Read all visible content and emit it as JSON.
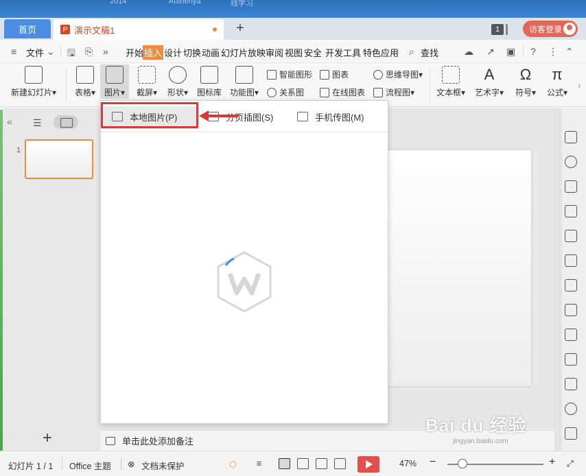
{
  "desktop": {
    "ghost_texts": [
      "2014",
      "Authenya",
      "线学习"
    ]
  },
  "tabs": {
    "home_label": "首页",
    "doc_label": "演示文稿1",
    "new_tab_symbol": "+",
    "badge_number": "1",
    "visitor_label": "访客登录"
  },
  "menubar": {
    "file_label": "文件",
    "items": [
      "开始",
      "插入",
      "设计",
      "切换",
      "动画",
      "幻灯片放映",
      "审阅",
      "视图",
      "安全",
      "开发工具",
      "特色应用"
    ],
    "active_item": "插入",
    "search_label": "查找"
  },
  "ribbon": {
    "new_slide": "新建幻灯片",
    "table": "表格",
    "picture": "图片",
    "screenshot": "截屏",
    "shape": "形状",
    "icon_lib": "图标库",
    "func_chart": "功能图",
    "smart_art": "智能图形",
    "chart": "图表",
    "relation": "关系图",
    "online_chart": "在线图表",
    "mind_map": "思维导图",
    "flow_chart": "流程图",
    "text_box": "文本框",
    "word_art": "艺术字",
    "symbol": "符号",
    "formula": "公式"
  },
  "picture_menu": {
    "options": [
      "本地图片(P)",
      "分页插图(S)",
      "手机传图(M)"
    ],
    "highlighted": "本地图片(P)"
  },
  "slides": {
    "current_number": "1"
  },
  "notes": {
    "placeholder": "单击此处添加备注"
  },
  "status": {
    "slide_counter": "幻灯片 1 / 1",
    "theme": "Office 主题",
    "protection": "文档未保护",
    "zoom": "47%",
    "zoom_fraction": 0.47
  },
  "watermark": {
    "text": "Bai du 经验",
    "sub": "jingyan.baidu.com"
  },
  "colors": {
    "accent": "#f08a3c",
    "tab_blue": "#4b8de3",
    "highlight_red": "#d63a3a",
    "play_red": "#e2504d"
  }
}
